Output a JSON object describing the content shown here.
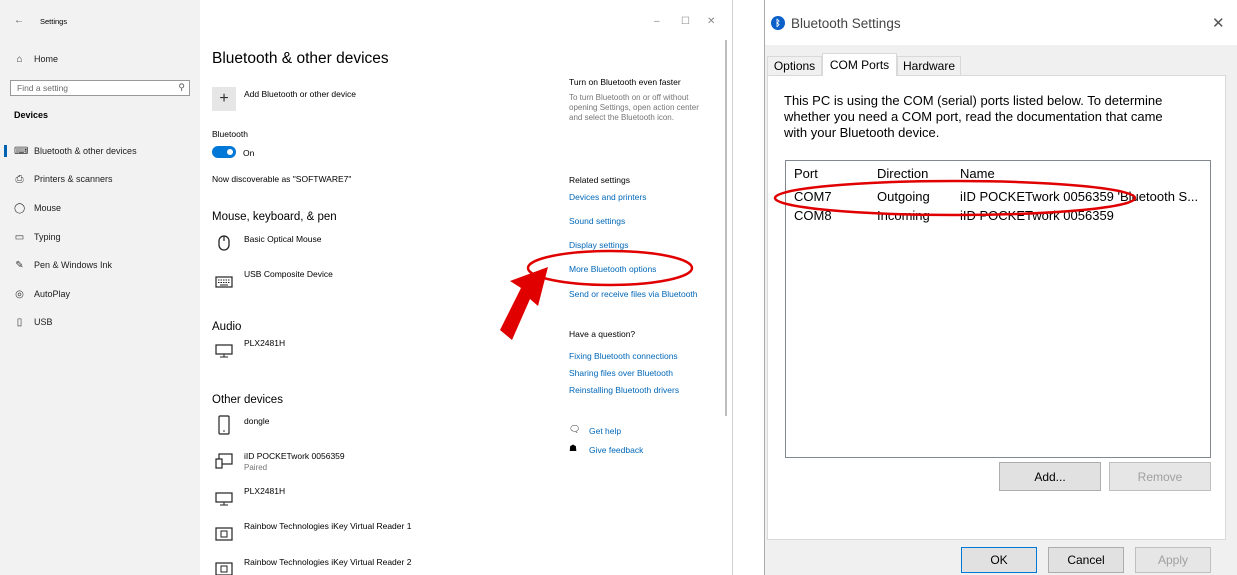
{
  "settings": {
    "title": "Settings",
    "window_controls": {
      "minimize": "–",
      "maximize": "☐",
      "close": "✕"
    },
    "sidebar": {
      "home": "Home",
      "search_placeholder": "Find a setting",
      "section": "Devices",
      "items": [
        {
          "label": "Bluetooth & other devices",
          "icon": "bluetooth-devices-icon",
          "glyph": "⌨",
          "selected": true
        },
        {
          "label": "Printers & scanners",
          "icon": "printer-icon",
          "glyph": "⎙"
        },
        {
          "label": "Mouse",
          "icon": "mouse-icon",
          "glyph": "⌒"
        },
        {
          "label": "Typing",
          "icon": "keyboard-icon",
          "glyph": "▭"
        },
        {
          "label": "Pen & Windows Ink",
          "icon": "pen-icon",
          "glyph": "✎"
        },
        {
          "label": "AutoPlay",
          "icon": "autoplay-icon",
          "glyph": "◎"
        },
        {
          "label": "USB",
          "icon": "usb-icon",
          "glyph": "▯"
        }
      ]
    },
    "main": {
      "heading": "Bluetooth & other devices",
      "add_device": "Add Bluetooth or other device",
      "bluetooth_label": "Bluetooth",
      "toggle_state": "On",
      "discoverable": "Now discoverable as \"SOFTWARE7\"",
      "mouse_section": "Mouse, keyboard, & pen",
      "mouse_devices": [
        {
          "name": "Basic Optical Mouse",
          "icon": "mouse-icon"
        },
        {
          "name": "USB Composite Device",
          "icon": "keyboard-icon"
        }
      ],
      "audio_section": "Audio",
      "audio_devices": [
        {
          "name": "PLX2481H",
          "icon": "monitor-icon"
        }
      ],
      "other_section": "Other devices",
      "other_devices": [
        {
          "name": "dongle",
          "sub": "",
          "icon": "phone-icon"
        },
        {
          "name": "iID POCKETwork 0056359",
          "sub": "Paired",
          "icon": "device-icon"
        },
        {
          "name": "PLX2481H",
          "sub": "",
          "icon": "monitor-icon"
        },
        {
          "name": "Rainbow Technologies iKey Virtual Reader 1",
          "sub": "",
          "icon": "reader-icon"
        },
        {
          "name": "Rainbow Technologies iKey Virtual Reader 2",
          "sub": "",
          "icon": "reader-icon"
        }
      ]
    },
    "right": {
      "faster_title": "Turn on Bluetooth even faster",
      "faster_body": "To turn Bluetooth on or off without opening Settings, open action center and select the Bluetooth icon.",
      "related_title": "Related settings",
      "related_links": [
        "Devices and printers",
        "Sound settings",
        "Display settings",
        "More Bluetooth options",
        "Send or receive files via Bluetooth"
      ],
      "question_title": "Have a question?",
      "question_links": [
        "Fixing Bluetooth connections",
        "Sharing files over Bluetooth",
        "Reinstalling Bluetooth drivers"
      ],
      "get_help": "Get help",
      "give_feedback": "Give feedback"
    }
  },
  "dialog": {
    "title": "Bluetooth Settings",
    "close": "✕",
    "tabs": [
      "Options",
      "COM Ports",
      "Hardware"
    ],
    "active_tab": "COM Ports",
    "description": "This PC is using the COM (serial) ports listed below. To determine whether you need a COM port, read the documentation that came with your Bluetooth device.",
    "columns": [
      "Port",
      "Direction",
      "Name"
    ],
    "rows": [
      {
        "port": "COM7",
        "direction": "Outgoing",
        "name": "iID POCKETwork 0056359 'Bluetooth S..."
      },
      {
        "port": "COM8",
        "direction": "Incoming",
        "name": "iID POCKETwork 0056359"
      }
    ],
    "buttons": {
      "add": "Add...",
      "remove": "Remove",
      "ok": "OK",
      "cancel": "Cancel",
      "apply": "Apply"
    }
  },
  "annotations": {
    "highlight_color": "#e00000"
  }
}
